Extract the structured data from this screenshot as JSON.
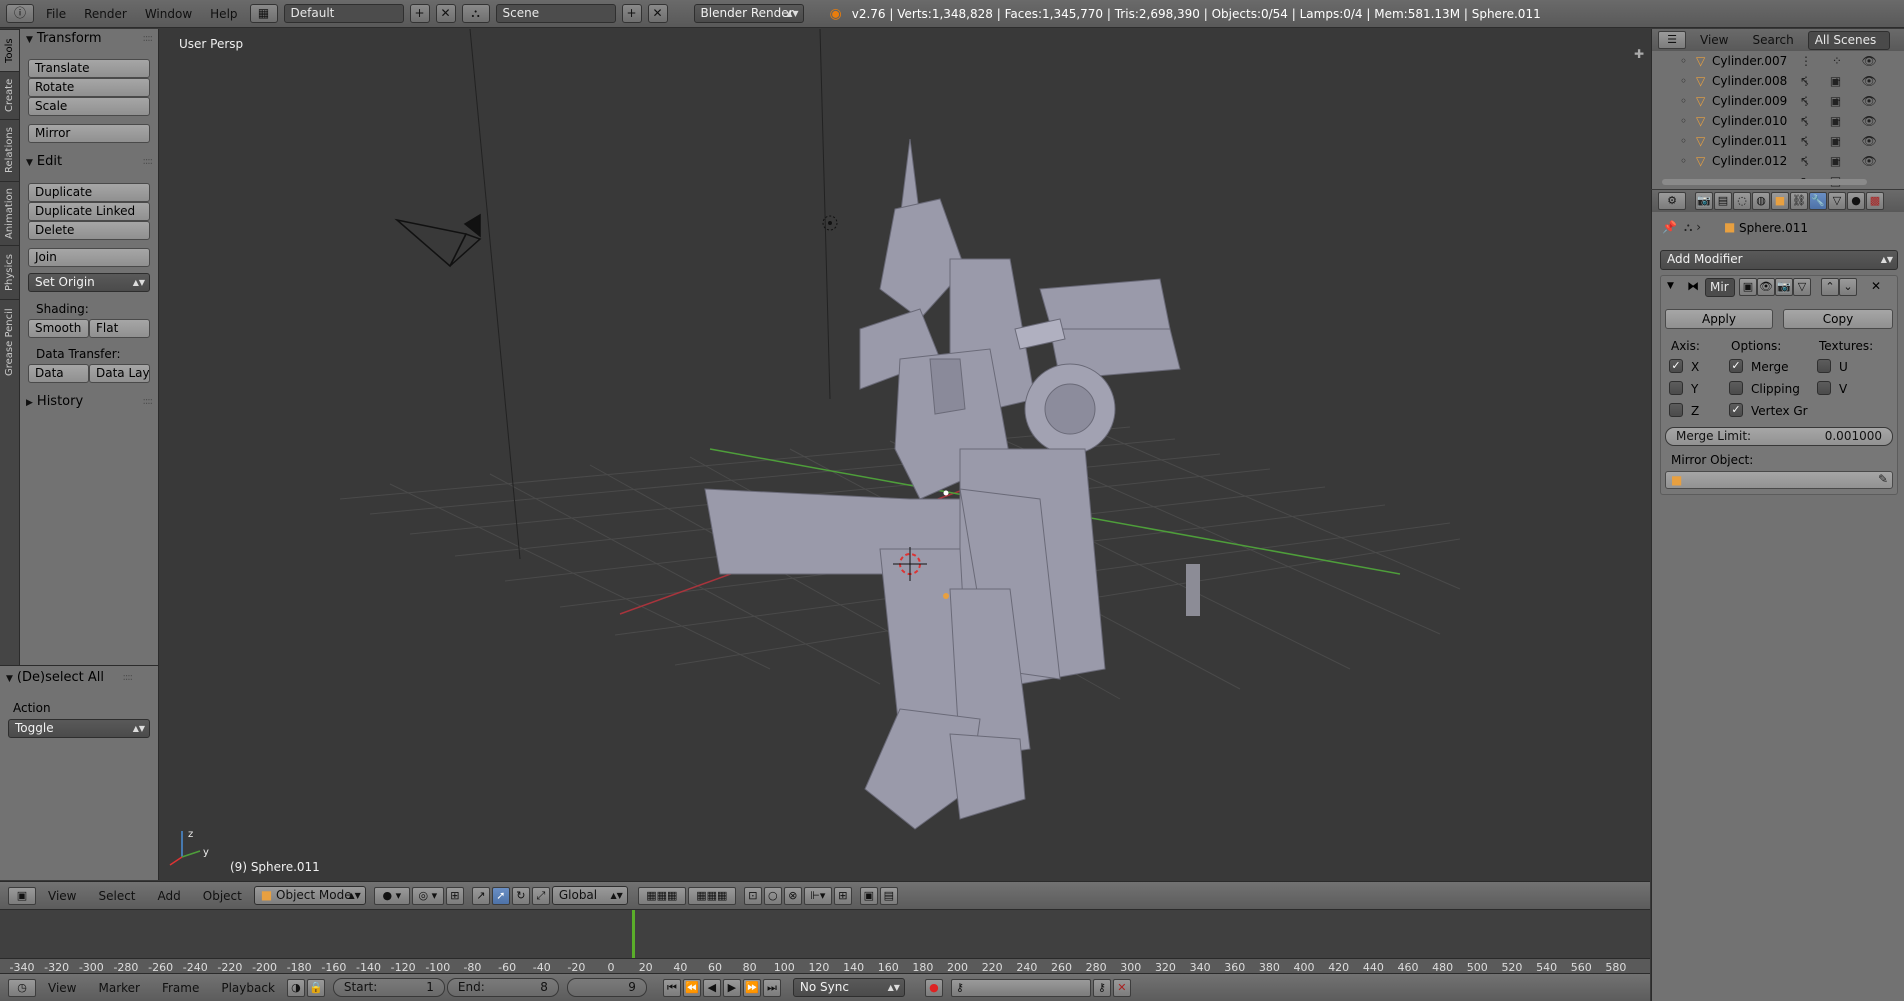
{
  "topbar": {
    "menus": [
      "File",
      "Render",
      "Window",
      "Help"
    ],
    "layout": "Default",
    "scene": "Scene",
    "engine": "Blender Render",
    "stats": "v2.76 | Verts:1,348,828 | Faces:1,345,770 | Tris:2,698,390 | Objects:0/54 | Lamps:0/4 | Mem:581.13M | Sphere.011"
  },
  "tabs": [
    "Tools",
    "Create",
    "Relations",
    "Animation",
    "Physics",
    "Grease Pencil"
  ],
  "toolshelf": {
    "transform": {
      "title": "Transform",
      "buttons": [
        "Translate",
        "Rotate",
        "Scale",
        "Mirror"
      ]
    },
    "edit": {
      "title": "Edit",
      "buttons": [
        "Duplicate",
        "Duplicate Linked",
        "Delete",
        "Join"
      ],
      "set_origin": "Set Origin",
      "shading_label": "Shading:",
      "smooth": "Smooth",
      "flat": "Flat",
      "data_transfer_label": "Data Transfer:",
      "data": "Data",
      "data_layout": "Data Layo"
    },
    "history": {
      "title": "History"
    },
    "operator": {
      "title": "(De)select All",
      "action_label": "Action",
      "action_value": "Toggle"
    }
  },
  "viewport": {
    "label": "User Persp",
    "object_label": "(9) Sphere.011"
  },
  "view_header": {
    "menus": [
      "View",
      "Select",
      "Add",
      "Object"
    ],
    "mode": "Object Mode",
    "orientation": "Global"
  },
  "timeline": {
    "ticks": [
      "-340",
      "-320",
      "-300",
      "-280",
      "-260",
      "-240",
      "-220",
      "-200",
      "-180",
      "-160",
      "-140",
      "-120",
      "-100",
      "-80",
      "-60",
      "-40",
      "-20",
      "0",
      "20",
      "40",
      "60",
      "80",
      "100",
      "120",
      "140",
      "160",
      "180",
      "200",
      "220",
      "240",
      "260",
      "280",
      "300",
      "320",
      "340",
      "360",
      "380",
      "400",
      "420",
      "440",
      "460",
      "480",
      "500",
      "520",
      "540",
      "560",
      "580"
    ],
    "menus": [
      "View",
      "Marker",
      "Frame",
      "Playback"
    ],
    "start_label": "Start:",
    "start_value": "1",
    "end_label": "End:",
    "end_value": "8",
    "current_frame": "9",
    "sync": "No Sync"
  },
  "outliner": {
    "header": {
      "view": "View",
      "search": "Search",
      "scenes": "All Scenes"
    },
    "items": [
      "Cylinder.007",
      "Cylinder.008",
      "Cylinder.009",
      "Cylinder.010",
      "Cylinder.011",
      "Cylinder.012"
    ]
  },
  "properties": {
    "object": "Sphere.011",
    "add_modifier": "Add Modifier",
    "modifier_name": "Mir",
    "apply": "Apply",
    "copy": "Copy",
    "axis_label": "Axis:",
    "options_label": "Options:",
    "textures_label": "Textures:",
    "axis": [
      {
        "label": "X",
        "checked": true
      },
      {
        "label": "Y",
        "checked": false
      },
      {
        "label": "Z",
        "checked": false
      }
    ],
    "options": [
      {
        "label": "Merge",
        "checked": true
      },
      {
        "label": "Clipping",
        "checked": false
      },
      {
        "label": "Vertex Gr",
        "checked": true
      }
    ],
    "textures": [
      {
        "label": "U",
        "checked": false
      },
      {
        "label": "V",
        "checked": false
      }
    ],
    "merge_limit_label": "Merge Limit:",
    "merge_limit_value": "0.001000",
    "mirror_object_label": "Mirror Object:"
  },
  "colors": {
    "background": "#393939",
    "panel": "#727272",
    "accent": "#5680c2",
    "current_frame": "#5aae2a",
    "x_axis": "#a8343c",
    "y_axis": "#4e9e3a"
  }
}
